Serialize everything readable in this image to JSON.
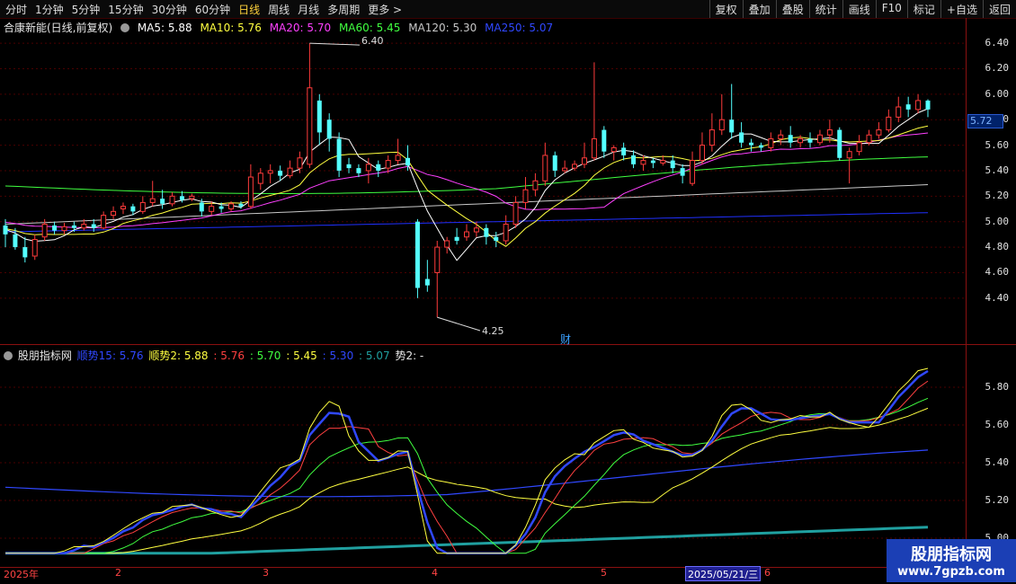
{
  "toolbar": {
    "periods": [
      "分时",
      "1分钟",
      "5分钟",
      "15分钟",
      "30分钟",
      "60分钟",
      "日线",
      "周线",
      "月线",
      "多周期",
      "更多 >"
    ],
    "active": "日线",
    "right_buttons": [
      "复权",
      "叠加",
      "叠股",
      "统计",
      "画线",
      "F10",
      "标记",
      "+自选",
      "返回"
    ]
  },
  "main_legend": {
    "title": "合康新能(日线,前复权)",
    "ma5": "MA5: 5.88",
    "ma10": "MA10: 5.76",
    "ma20": "MA20: 5.70",
    "ma60": "MA60: 5.45",
    "ma120": "MA120: 5.30",
    "ma250": "MA250: 5.07"
  },
  "sub_legend": {
    "title": "股朋指标网",
    "shunshi1": "顺势15: 5.76",
    "shunshi2": "顺势2: 5.88",
    "v1": ": 5.76",
    "v2": ": 5.70",
    "v3": ": 5.45",
    "v4": ": 5.30",
    "v5": ": 5.07",
    "shi2": "势2: -"
  },
  "price_axis": [
    "6.40",
    "6.20",
    "6.00",
    "5.80",
    "5.60",
    "5.40",
    "5.20",
    "5.00",
    "4.80",
    "4.60",
    "4.40"
  ],
  "sub_axis": [
    "5.80",
    "5.60",
    "5.40",
    "5.20",
    "5.00"
  ],
  "last_price": "5.72",
  "high_mark": "6.40",
  "low_mark": "4.25",
  "cai_label": "财",
  "x_labels": [
    "2025年",
    "2",
    "3",
    "4",
    "5",
    "6"
  ],
  "date_box": "2025/05/21/三",
  "watermark": {
    "title": "股朋指标网",
    "url": "www.7gpzb.com"
  },
  "colors": {
    "up": "#ff3b3b",
    "down": "#54ffff",
    "ma5": "#ffffff",
    "ma10": "#ffff40",
    "ma20": "#ff40ff",
    "ma60": "#40ff40",
    "ma120": "#c0c0c0",
    "ma250": "#2030ff"
  },
  "chart_data": {
    "type": "candlestick",
    "ylim": [
      4.25,
      6.5
    ],
    "candles": [
      [
        4.97,
        4.9,
        5.02,
        4.8
      ],
      [
        4.9,
        4.8,
        4.95,
        4.78
      ],
      [
        4.8,
        4.72,
        4.88,
        4.68
      ],
      [
        4.73,
        4.86,
        4.9,
        4.7
      ],
      [
        4.88,
        4.98,
        5.02,
        4.85
      ],
      [
        4.97,
        4.93,
        5.0,
        4.9
      ],
      [
        4.93,
        4.96,
        4.99,
        4.9
      ],
      [
        4.97,
        4.95,
        5.0,
        4.92
      ],
      [
        4.95,
        4.98,
        5.02,
        4.93
      ],
      [
        4.98,
        4.95,
        5.02,
        4.92
      ],
      [
        4.95,
        5.05,
        5.08,
        4.94
      ],
      [
        5.05,
        5.08,
        5.12,
        5.02
      ],
      [
        5.1,
        5.12,
        5.15,
        5.06
      ],
      [
        5.12,
        5.08,
        5.14,
        5.05
      ],
      [
        5.08,
        5.15,
        5.2,
        5.06
      ],
      [
        5.15,
        5.18,
        5.32,
        5.12
      ],
      [
        5.18,
        5.14,
        5.25,
        5.1
      ],
      [
        5.14,
        5.2,
        5.23,
        5.12
      ],
      [
        5.2,
        5.17,
        5.24,
        5.15
      ],
      [
        5.18,
        5.2,
        5.22,
        5.16
      ],
      [
        5.15,
        5.08,
        5.18,
        5.04
      ],
      [
        5.08,
        5.12,
        5.16,
        5.05
      ],
      [
        5.12,
        5.1,
        5.15,
        5.07
      ],
      [
        5.1,
        5.14,
        5.16,
        5.08
      ],
      [
        5.14,
        5.12,
        5.16,
        5.1
      ],
      [
        5.12,
        5.35,
        5.45,
        5.1
      ],
      [
        5.3,
        5.38,
        5.42,
        5.25
      ],
      [
        5.38,
        5.4,
        5.45,
        5.3
      ],
      [
        5.4,
        5.36,
        5.44,
        5.32
      ],
      [
        5.36,
        5.42,
        5.48,
        5.34
      ],
      [
        5.42,
        5.5,
        5.55,
        5.38
      ],
      [
        5.45,
        6.05,
        6.4,
        5.42
      ],
      [
        5.95,
        5.7,
        6.0,
        5.6
      ],
      [
        5.8,
        5.65,
        5.85,
        5.55
      ],
      [
        5.65,
        5.4,
        5.7,
        5.35
      ],
      [
        5.45,
        5.42,
        5.5,
        5.38
      ],
      [
        5.42,
        5.38,
        5.45,
        5.35
      ],
      [
        5.4,
        5.45,
        5.5,
        5.3
      ],
      [
        5.45,
        5.4,
        5.48,
        5.35
      ],
      [
        5.42,
        5.48,
        5.52,
        5.38
      ],
      [
        5.48,
        5.52,
        5.65,
        5.45
      ],
      [
        5.5,
        5.44,
        5.6,
        5.4
      ],
      [
        5.0,
        4.48,
        5.02,
        4.4
      ],
      [
        4.55,
        4.5,
        4.7,
        4.45
      ],
      [
        4.6,
        4.8,
        4.85,
        4.25
      ],
      [
        4.8,
        4.85,
        4.88,
        4.75
      ],
      [
        4.88,
        4.85,
        4.95,
        4.82
      ],
      [
        4.88,
        4.92,
        4.98,
        4.85
      ],
      [
        4.92,
        4.95,
        5.0,
        4.88
      ],
      [
        4.95,
        4.88,
        4.98,
        4.82
      ],
      [
        4.88,
        4.85,
        4.92,
        4.8
      ],
      [
        4.85,
        4.98,
        5.05,
        4.82
      ],
      [
        4.98,
        5.15,
        5.2,
        4.95
      ],
      [
        5.15,
        5.25,
        5.35,
        5.1
      ],
      [
        5.25,
        5.32,
        5.38,
        5.2
      ],
      [
        5.32,
        5.52,
        5.62,
        5.28
      ],
      [
        5.52,
        5.4,
        5.55,
        5.35
      ],
      [
        5.4,
        5.42,
        5.48,
        5.38
      ],
      [
        5.42,
        5.45,
        5.48,
        5.4
      ],
      [
        5.45,
        5.5,
        5.62,
        5.42
      ],
      [
        5.5,
        5.65,
        6.25,
        5.48
      ],
      [
        5.72,
        5.55,
        5.75,
        5.5
      ],
      [
        5.55,
        5.58,
        5.6,
        5.48
      ],
      [
        5.58,
        5.52,
        5.62,
        5.48
      ],
      [
        5.52,
        5.45,
        5.56,
        5.42
      ],
      [
        5.45,
        5.48,
        5.52,
        5.4
      ],
      [
        5.48,
        5.46,
        5.5,
        5.42
      ],
      [
        5.46,
        5.48,
        5.52,
        5.44
      ],
      [
        5.48,
        5.42,
        5.52,
        5.38
      ],
      [
        5.42,
        5.36,
        5.45,
        5.3
      ],
      [
        5.3,
        5.48,
        5.55,
        5.28
      ],
      [
        5.48,
        5.6,
        5.7,
        5.45
      ],
      [
        5.6,
        5.72,
        5.85,
        5.55
      ],
      [
        5.72,
        5.8,
        6.0,
        5.68
      ],
      [
        5.8,
        5.7,
        6.08,
        5.65
      ],
      [
        5.7,
        5.62,
        5.78,
        5.58
      ],
      [
        5.62,
        5.6,
        5.65,
        5.55
      ],
      [
        5.6,
        5.58,
        5.62,
        5.55
      ],
      [
        5.58,
        5.65,
        5.7,
        5.55
      ],
      [
        5.65,
        5.68,
        5.72,
        5.6
      ],
      [
        5.68,
        5.62,
        5.75,
        5.58
      ],
      [
        5.62,
        5.65,
        5.68,
        5.58
      ],
      [
        5.65,
        5.62,
        5.7,
        5.58
      ],
      [
        5.62,
        5.68,
        5.72,
        5.6
      ],
      [
        5.68,
        5.72,
        5.8,
        5.62
      ],
      [
        5.72,
        5.5,
        5.74,
        5.48
      ],
      [
        5.5,
        5.55,
        5.58,
        5.3
      ],
      [
        5.55,
        5.62,
        5.68,
        5.52
      ],
      [
        5.62,
        5.68,
        5.72,
        5.6
      ],
      [
        5.68,
        5.72,
        5.78,
        5.65
      ],
      [
        5.72,
        5.82,
        5.88,
        5.7
      ],
      [
        5.82,
        5.9,
        5.98,
        5.78
      ],
      [
        5.92,
        5.88,
        5.98,
        5.82
      ],
      [
        5.88,
        5.95,
        6.0,
        5.85
      ],
      [
        5.95,
        5.88,
        5.96,
        5.82
      ]
    ]
  }
}
